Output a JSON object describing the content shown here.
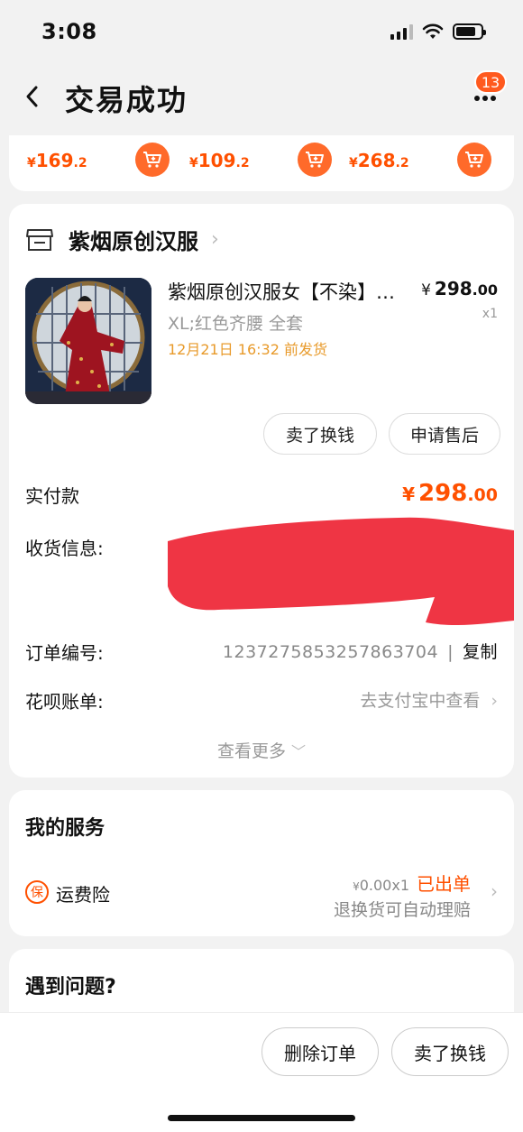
{
  "status_bar": {
    "time": "3:08"
  },
  "header": {
    "title": "交易成功",
    "badge_count": "13"
  },
  "recommendations": [
    {
      "yen": "¥",
      "price_int": "169",
      "price_dec": ".2"
    },
    {
      "yen": "¥",
      "price_int": "109",
      "price_dec": ".2"
    },
    {
      "yen": "¥",
      "price_int": "268",
      "price_dec": ".2"
    }
  ],
  "shop": {
    "name": "紫烟原创汉服"
  },
  "product": {
    "title": "紫烟原创汉服女【不染】…",
    "price_yen": "¥",
    "price_int": "298",
    "price_dec": ".00",
    "quantity": "x1",
    "sku": "XL;红色齐腰 全套",
    "ship_time": "12月21日 16:32 前发货",
    "buttons": {
      "sell": "卖了换钱",
      "after_sale": "申请售后"
    }
  },
  "payment": {
    "label": "实付款",
    "yen": "¥",
    "amount_int": "298",
    "amount_dec": ".00"
  },
  "shipping": {
    "label": "收货信息:"
  },
  "order": {
    "label": "订单编号:",
    "number": "1237275853257863704",
    "separator": "|",
    "copy_label": "复制"
  },
  "huabei": {
    "label": "花呗账单:",
    "link_text": "去支付宝中查看"
  },
  "see_more": "查看更多",
  "services": {
    "title": "我的服务",
    "icon_text": "保",
    "insurance_name": "运费险",
    "price_yen": "¥",
    "price_value": "0.00",
    "price_qty": "x1",
    "status": "已出单",
    "subtitle": "退换货可自动理赔"
  },
  "help": {
    "title": "遇到问题?"
  },
  "bottom_bar": {
    "delete_label": "删除订单",
    "sell_label": "卖了换钱"
  },
  "colors": {
    "accent": "#ff5000",
    "ship_time": "#e89a2a",
    "redaction": "#ee2a3a"
  }
}
